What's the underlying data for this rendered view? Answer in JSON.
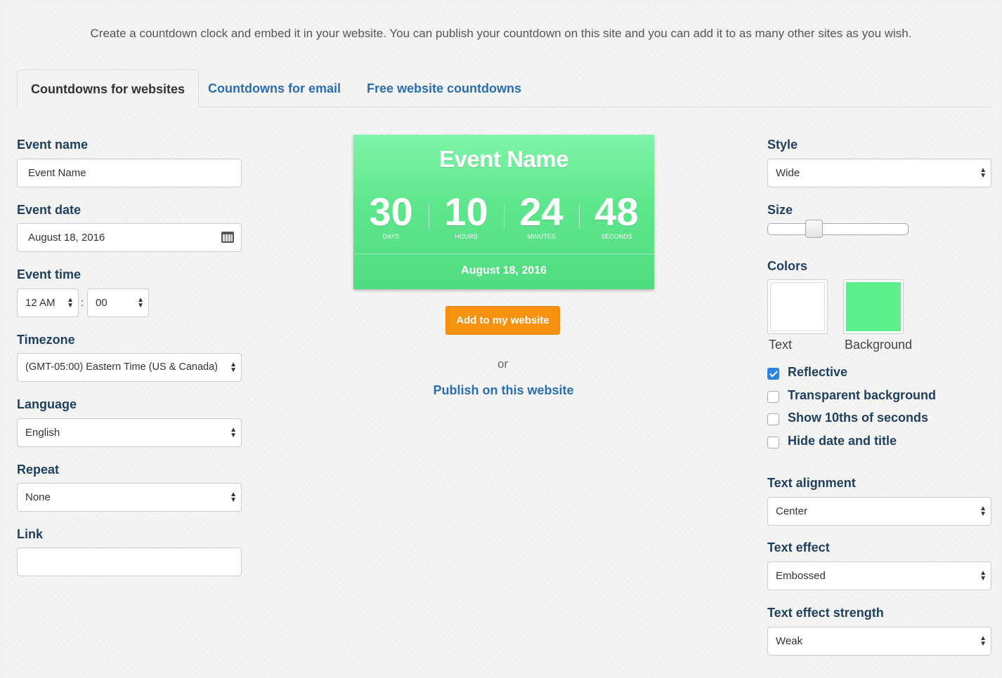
{
  "intro": "Create a countdown clock and embed it in your website. You can publish your countdown on this site and you can add it to as many other sites as you wish.",
  "tabs": [
    {
      "label": "Countdowns for websites",
      "active": true
    },
    {
      "label": "Countdowns for email",
      "active": false
    },
    {
      "label": "Free website countdowns",
      "active": false
    }
  ],
  "left": {
    "event_name": {
      "label": "Event name",
      "value": "Event Name"
    },
    "event_date": {
      "label": "Event date",
      "value": "August 18, 2016",
      "icon": "calendar-icon"
    },
    "event_time": {
      "label": "Event time",
      "hour": "12 AM",
      "minute": "00",
      "separator": ":"
    },
    "timezone": {
      "label": "Timezone",
      "value": "(GMT-05:00) Eastern Time (US & Canada)"
    },
    "language": {
      "label": "Language",
      "value": "English"
    },
    "repeat": {
      "label": "Repeat",
      "value": "None"
    },
    "link": {
      "label": "Link",
      "value": ""
    }
  },
  "preview": {
    "title": "Event Name",
    "units": [
      {
        "value": "30",
        "label": "DAYS"
      },
      {
        "value": "10",
        "label": "HOURS"
      },
      {
        "value": "24",
        "label": "MINUTES"
      },
      {
        "value": "48",
        "label": "SECONDS"
      }
    ],
    "date": "August 18, 2016",
    "color": "#5ee68c",
    "add_button": "Add to my website",
    "or": "or",
    "publish_link": "Publish on this website"
  },
  "right": {
    "style": {
      "label": "Style",
      "value": "Wide"
    },
    "size": {
      "label": "Size",
      "level": 0.27
    },
    "colors": {
      "label": "Colors",
      "text": {
        "label": "Text",
        "color": "#ffffff"
      },
      "background": {
        "label": "Background",
        "color": "#5ef08f"
      }
    },
    "options": [
      {
        "label": "Reflective",
        "checked": true
      },
      {
        "label": "Transparent background",
        "checked": false
      },
      {
        "label": "Show 10ths of seconds",
        "checked": false
      },
      {
        "label": "Hide date and title",
        "checked": false
      }
    ],
    "text_alignment": {
      "label": "Text alignment",
      "value": "Center"
    },
    "text_effect": {
      "label": "Text effect",
      "value": "Embossed"
    },
    "text_effect_strength": {
      "label": "Text effect strength",
      "value": "Weak"
    }
  },
  "colors": {
    "link": "#2a6db0",
    "label": "#1f3f5f",
    "accent_button": "#f6920f",
    "checkbox": "#2d83e0"
  }
}
